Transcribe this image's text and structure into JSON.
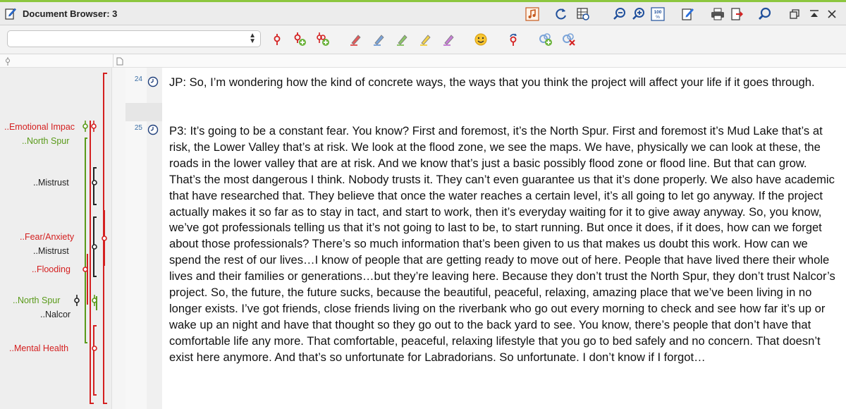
{
  "window": {
    "title": "Document Browser: 3"
  },
  "toolbar": {
    "icons": [
      "music-note-icon",
      "refresh-icon",
      "table-refresh-icon",
      "zoom-out-icon",
      "zoom-in-icon",
      "zoom-100-icon",
      "edit-icon",
      "print-icon",
      "export-icon",
      "search-icon",
      "restore-window-icon",
      "collapse-icon",
      "close-icon"
    ]
  },
  "coding_toolbar": {
    "combo_value": "",
    "icons": [
      "code-icon",
      "add-code-icon",
      "code-plus-icon",
      "highlighter-red-icon",
      "highlighter-blue-icon",
      "highlighter-green-icon",
      "highlighter-yellow-icon",
      "highlighter-purple-icon",
      "emoticon-icon",
      "link-code-icon",
      "add-link-icon",
      "remove-link-icon"
    ]
  },
  "margin": {
    "codes": [
      {
        "label": "..Emotional Impac",
        "color": "red"
      },
      {
        "label": "..North Spur",
        "color": "green"
      },
      {
        "label": "..Mistrust",
        "color": "black"
      },
      {
        "label": "..Fear/Anxiety",
        "color": "red"
      },
      {
        "label": "..Mistrust",
        "color": "black"
      },
      {
        "label": "..Flooding",
        "color": "red"
      },
      {
        "label": "..North Spur",
        "color": "green"
      },
      {
        "label": "..Nalcor",
        "color": "black"
      },
      {
        "label": "..Mental Health",
        "color": "red"
      }
    ]
  },
  "document": {
    "paragraphs": [
      {
        "number": "24",
        "text": "JP: So, I’m wondering how the kind of concrete ways, the ways that you think the project will affect your life if it goes through."
      },
      {
        "number": "25",
        "text": "P3: It’s going to be a constant fear. You know? First and foremost, it’s the North Spur. First and foremost it’s Mud Lake that’s at risk, the Lower Valley that’s at risk. We look at the flood zone, we see the maps. We have, physically we can look at these, the roads in the lower valley that are at risk. And we know that’s just a basic possibly flood zone or flood line. But that can grow. That’s the most dangerous I think. Nobody trusts it. They can’t even guarantee us that it’s done properly. We also have academic that have researched that. They believe that once the water reaches a certain level, it’s all going to let go anyway. If the project actually makes it so far as to stay in tact, and start to work, then it’s everyday waiting for it to give away anyway. So, you know, we’ve got professionals telling us that it’s not going to last to be, to start running. But once it does, if it does, how can we forget about those professionals? There’s so much information that’s been given to us that makes us doubt this work. How can we spend the rest of our lives…I know of people that are getting ready to move out of here. People that have lived there their whole lives and their families or generations…but they’re leaving here. Because they don’t trust the North Spur, they don’t trust Nalcor’s project. So, the future, the future sucks, because the beautiful, peaceful, relaxing, amazing place that we’ve been living in no longer exists. I’ve got friends, close friends living on the riverbank who go out every morning to check and see how far it’s up or wake up an night and have that thought so they go out to the back yard to see. You know, there’s people that don’t have that comfortable life any more. That comfortable, peaceful, relaxing lifestyle that you go to bed safely and no concern. That doesn’t exist here anymore. And that’s so unfortunate for Labradorians. So unfortunate. I don’t know if I forgot…"
      }
    ]
  },
  "colors": {
    "red": "#d42020",
    "green": "#5a9a1a",
    "black": "#222222",
    "accent": "#8cc63f"
  }
}
